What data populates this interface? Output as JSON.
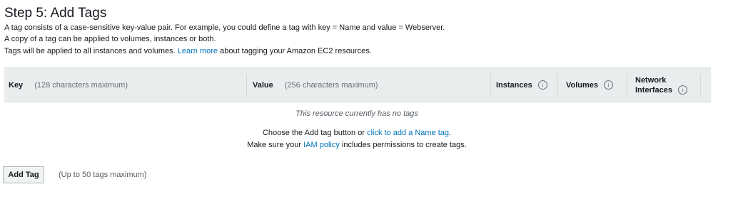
{
  "page": {
    "title": "Step 5: Add Tags",
    "desc1": "A tag consists of a case-sensitive key-value pair. For example, you could define a tag with key = Name and value = Webserver.",
    "desc2": "A copy of a tag can be applied to volumes, instances or both.",
    "desc3_pre": "Tags will be applied to all instances and volumes.",
    "desc3_link": "Learn more",
    "desc3_post": "about tagging your Amazon EC2 resources."
  },
  "table": {
    "key_label": "Key",
    "key_hint": "(128 characters maximum)",
    "value_label": "Value",
    "value_hint": "(256 characters maximum)",
    "instances_label": "Instances",
    "volumes_label": "Volumes",
    "network_label_1": "Network",
    "network_label_2": "Interfaces",
    "info_glyph": "i",
    "empty_text": "This resource currently has no tags"
  },
  "cta": {
    "line1_pre": "Choose the Add tag button or",
    "line1_link": "click to add a Name tag",
    "line1_post": ".",
    "line2_pre": "Make sure your",
    "line2_link": "IAM policy",
    "line2_post": "includes permissions to create tags."
  },
  "footer": {
    "add_tag_label": "Add Tag",
    "limit_hint": "(Up to 50 tags maximum)"
  },
  "colors": {
    "link": "#0073bb",
    "header_bg": "#eaeded"
  }
}
